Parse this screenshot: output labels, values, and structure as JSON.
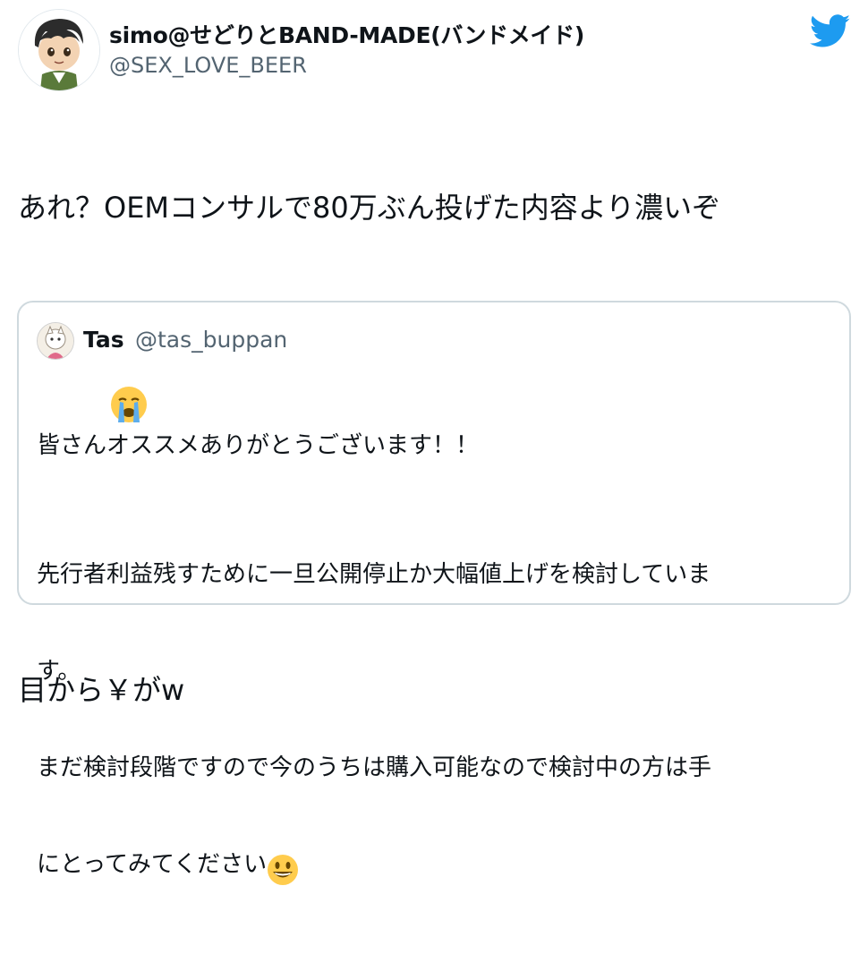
{
  "author": {
    "display_name": "simo@せどりとBAND-MADE(バンドメイド)",
    "handle": "@SEX_LOVE_BEER"
  },
  "tweet": {
    "line1": "あれ？OEMコンサルで80万ぶん投げた内容より濃いぞ",
    "line3": "目から￥がw"
  },
  "quoted_tweet": {
    "display_name": "Tas",
    "handle": "@tas_buppan",
    "line1": "皆さんオススメありがとうございます！！",
    "line2": "先行者利益残すために一旦公開停止か大幅値上げを検討していま",
    "line3": "す。",
    "line4": "まだ検討段階ですので今のうちは購入可能なので検討中の方は手",
    "line5": "にとってみてください"
  },
  "icons": {
    "twitter": "twitter-bird-icon",
    "crying": "loudly-crying-face-emoji",
    "grinning": "grinning-face-emoji"
  },
  "colors": {
    "twitter_blue": "#1d9bf0",
    "handle_gray": "#536471",
    "border": "#cfd9de"
  }
}
